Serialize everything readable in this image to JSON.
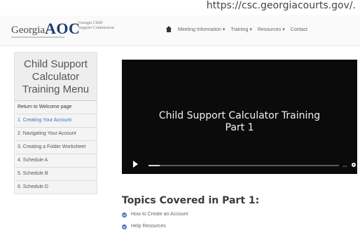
{
  "url_caption": "https://csc.georgiacourts.gov/.",
  "header": {
    "logo_georgia": "Georgia",
    "logo_aoc": "AOC",
    "gcsc_line1": "Georgia Child",
    "gcsc_line2": "Support Commission",
    "nav": [
      "Meeting Information",
      "Training",
      "Resources",
      "Contact"
    ]
  },
  "sidebar": {
    "title": "Child Support Calculator Training Menu",
    "welcome": "Return to Welcome page",
    "items": [
      "1. Creating Your Account",
      "2. Navigating Your Account",
      "3. Creating a Folder Worksheet",
      "4. Schedule A",
      "5. Schedule B",
      "6. Schedule D"
    ],
    "active_index": 0
  },
  "video": {
    "title_line1": "Child Support Calculator Training",
    "title_line2": "Part 1",
    "progress": 0.06
  },
  "topics": {
    "heading": "Topics Covered in Part 1:",
    "items": [
      "How to Create an Account",
      "Help Resources"
    ]
  }
}
